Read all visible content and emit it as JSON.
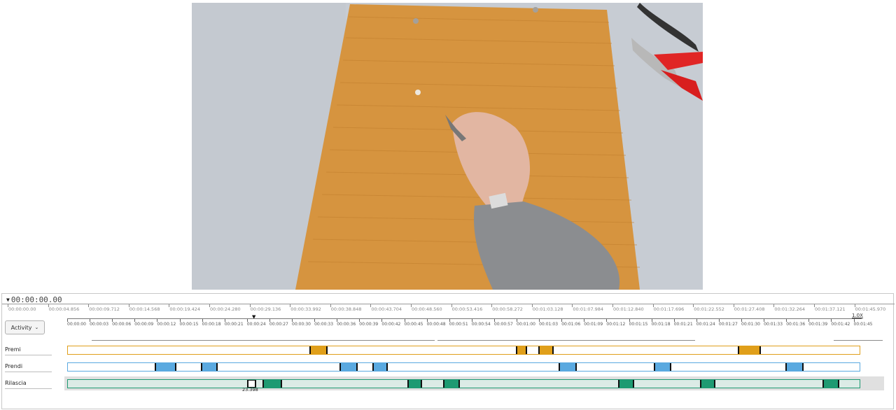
{
  "timecode": "00:00:00.00",
  "top_ruler_labels": [
    "00:00:00.00",
    "00:00:04.856",
    "00:00:09.712",
    "00:00:14.568",
    "00:00:19.424",
    "00:00:24.280",
    "00:00:29.136",
    "00:00:33.992",
    "00:00:38.848",
    "00:00:43.704",
    "00:00:48.560",
    "00:00:53.416",
    "00:00:58.272",
    "00:01:03.128",
    "00:01:07.984",
    "00:01:12.840",
    "00:01:17.696",
    "00:01:22.552",
    "00:01:27.408",
    "00:01:32.264",
    "00:01:37.121",
    "00:01:45.970"
  ],
  "bottom_ruler_labels": [
    "00:00:00",
    "00:00:03",
    "00:00:06",
    "00:00:09",
    "00:00:12",
    "00:00:15",
    "00:00:18",
    "00:00:21",
    "00:00:24",
    "00:00:27",
    "00:00:30",
    "00:00:33",
    "00:00:36",
    "00:00:39",
    "00:00:42",
    "00:00:45",
    "00:00:48",
    "00:00:51",
    "00:00:54",
    "00:00:57",
    "00:01:00",
    "00:01:03",
    "00:01:06",
    "00:01:09",
    "00:01:12",
    "00:01:15",
    "00:01:18",
    "00:01:21",
    "00:01:24",
    "00:01:27",
    "00:01:30",
    "00:01:33",
    "00:01:36",
    "00:01:39",
    "00:01:42",
    "00:01:45"
  ],
  "zoom_level": "1.0X",
  "activity_button": {
    "label": "Activity",
    "icon": "chevron-down-icon"
  },
  "selected_marker_label": "23.398",
  "tracks": [
    {
      "label": "Premi",
      "color": "#e09f1a",
      "segments": [
        [
          30.5,
          32.8
        ],
        [
          56.6,
          58.0
        ],
        [
          59.4,
          61.4
        ],
        [
          84.6,
          87.5
        ]
      ]
    },
    {
      "label": "Prendi",
      "color": "#5aa9e0",
      "segments": [
        [
          11.0,
          13.7
        ],
        [
          16.8,
          18.9
        ],
        [
          34.3,
          36.6
        ],
        [
          38.5,
          40.4
        ],
        [
          62.0,
          64.3
        ],
        [
          74.0,
          76.2
        ],
        [
          90.6,
          92.9
        ]
      ]
    },
    {
      "label": "Rilascia",
      "color": "#1e9a72",
      "segments": [
        [
          22.6,
          23.8
        ],
        [
          24.6,
          27.1
        ],
        [
          42.9,
          44.7
        ],
        [
          47.4,
          49.5
        ],
        [
          69.5,
          71.5
        ],
        [
          79.8,
          81.8
        ],
        [
          95.3,
          97.4
        ]
      ]
    }
  ],
  "timeline_duration_seconds": 100
}
